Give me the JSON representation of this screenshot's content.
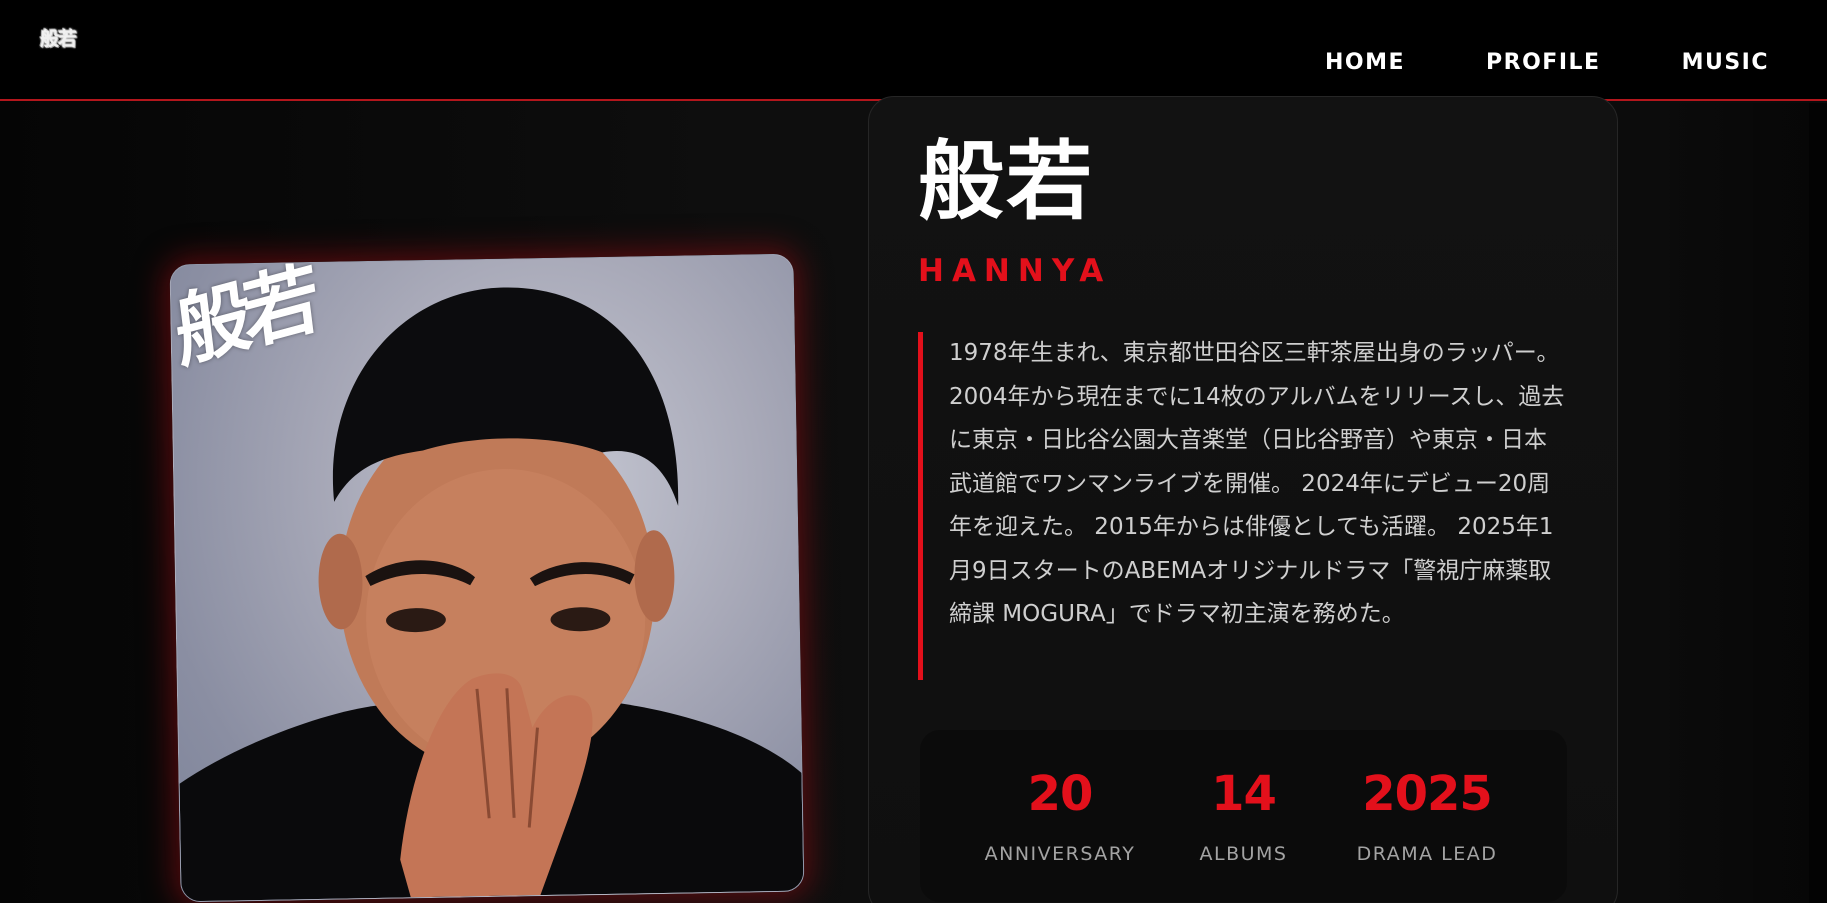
{
  "header": {
    "logo": "般若",
    "nav": [
      "HOME",
      "PROFILE",
      "MUSIC"
    ]
  },
  "photo": {
    "watermark": "般若"
  },
  "profile": {
    "name_jp": "般若",
    "name_en": "HANNYA",
    "bio": "1978年生まれ、東京都世田谷区三軒茶屋出身のラッパー。 2004年から現在までに14枚のアルバムをリリースし、過去に東京・日比谷公園大音楽堂（日比谷野音）や東京・日本武道館でワンマンライブを開催。 2024年にデビュー20周年を迎えた。 2015年からは俳優としても活躍。 2025年1月9日スタートのABEMAオリジナルドラマ「警視庁麻薬取締課 MOGURA」でドラマ初主演を務めた。",
    "stats": [
      {
        "value": "20",
        "label": "ANNIVERSARY"
      },
      {
        "value": "14",
        "label": "ALBUMS"
      },
      {
        "value": "2025",
        "label": "DRAMA LEAD"
      }
    ]
  },
  "colors": {
    "accent": "#e3101b",
    "background": "#0b0b0b",
    "header": "#000000"
  }
}
